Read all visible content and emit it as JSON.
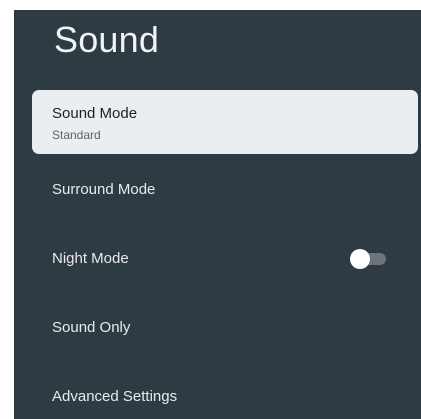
{
  "header": {
    "title": "Sound"
  },
  "menu": {
    "items": [
      {
        "label": "Sound Mode",
        "value": "Standard"
      },
      {
        "label": "Surround Mode"
      },
      {
        "label": "Night Mode",
        "toggle_on": false
      },
      {
        "label": "Sound Only"
      },
      {
        "label": "Advanced Settings"
      }
    ]
  },
  "colors": {
    "panel_background": "#2e3b42",
    "focus_background": "#e9eef2",
    "text_primary": "#e8eaed",
    "toggle_track_off": "#6b757b",
    "toggle_knob": "#ffffff"
  }
}
